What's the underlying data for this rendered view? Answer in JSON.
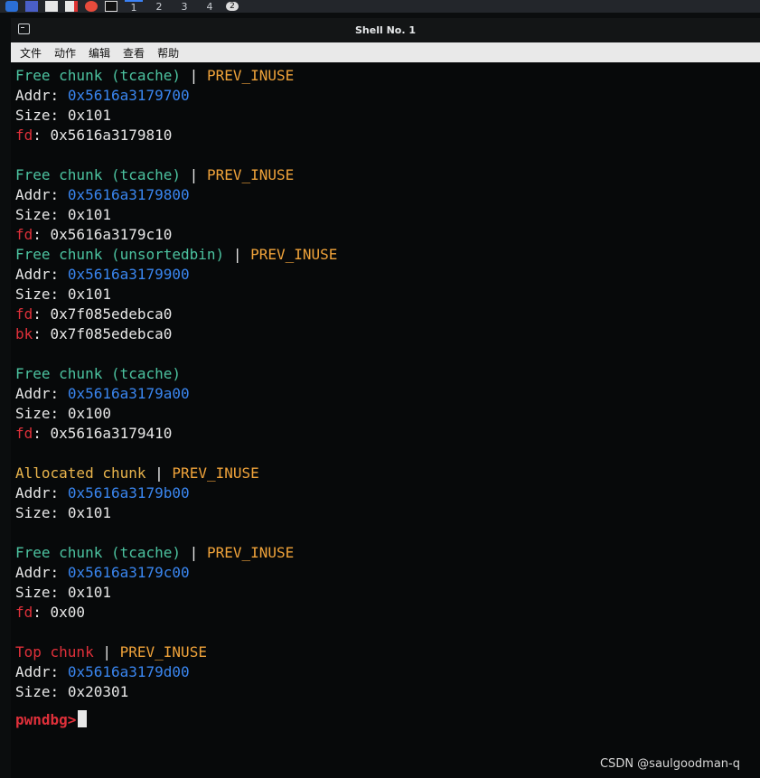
{
  "window": {
    "title": "Shell No. 1"
  },
  "taskbar": {
    "workspaces": [
      "1",
      "2",
      "3",
      "4"
    ],
    "badge": "2"
  },
  "menu": {
    "items": [
      "文件",
      "动作",
      "编辑",
      "查看",
      "帮助"
    ]
  },
  "colors": {
    "free": "#4cc3a0",
    "inuse": "#f0a33a",
    "addr": "#3a86f0",
    "red": "#e0303a",
    "text": "#e8e8e8"
  },
  "chunks": [
    {
      "type": "Free chunk (tcache)",
      "flag": "PREV_INUSE",
      "addr": "0x5616a3179700",
      "size": "0x101",
      "fd": "0x5616a3179810"
    },
    {
      "type": "Free chunk (tcache)",
      "flag": "PREV_INUSE",
      "addr": "0x5616a3179800",
      "size": "0x101",
      "fd": "0x5616a3179c10"
    },
    {
      "type": "Free chunk (unsortedbin)",
      "flag": "PREV_INUSE",
      "addr": "0x5616a3179900",
      "size": "0x101",
      "fd": "0x7f085edebca0",
      "bk": "0x7f085edebca0"
    },
    {
      "type": "Free chunk (tcache)",
      "flag": "",
      "addr": "0x5616a3179a00",
      "size": "0x100",
      "fd": "0x5616a3179410"
    },
    {
      "type": "Allocated chunk",
      "flag": "PREV_INUSE",
      "addr": "0x5616a3179b00",
      "size": "0x101"
    },
    {
      "type": "Free chunk (tcache)",
      "flag": "PREV_INUSE",
      "addr": "0x5616a3179c00",
      "size": "0x101",
      "fd": "0x00"
    },
    {
      "type": "Top chunk",
      "flag": "PREV_INUSE",
      "addr": "0x5616a3179d00",
      "size": "0x20301"
    }
  ],
  "labels": {
    "addr": "Addr:",
    "size": "Size:",
    "fd": "fd",
    "bk": "bk",
    "separator": "|"
  },
  "prompt": "pwndbg>",
  "watermark": "CSDN @saulgoodman-q"
}
